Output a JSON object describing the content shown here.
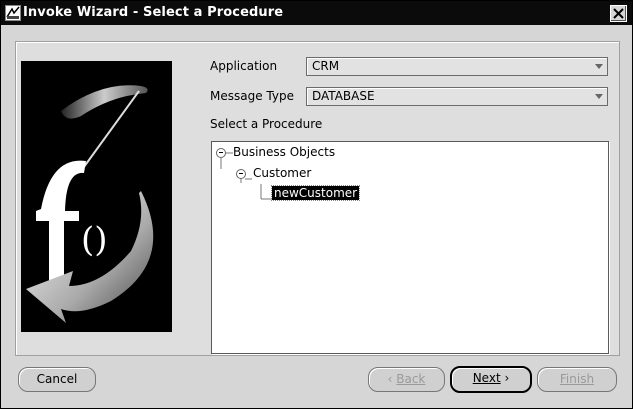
{
  "window": {
    "title": "Invoke Wizard - Select a Procedure"
  },
  "form": {
    "application_label": "Application",
    "application_value": "CRM",
    "message_type_label": "Message Type",
    "message_type_value": "DATABASE",
    "procedure_label": "Select a Procedure"
  },
  "tree": {
    "root": "Business Objects",
    "child": "Customer",
    "leaf": "newCustomer"
  },
  "buttons": {
    "cancel": "Cancel",
    "back": "Back",
    "next": "Next",
    "finish": "Finish"
  }
}
